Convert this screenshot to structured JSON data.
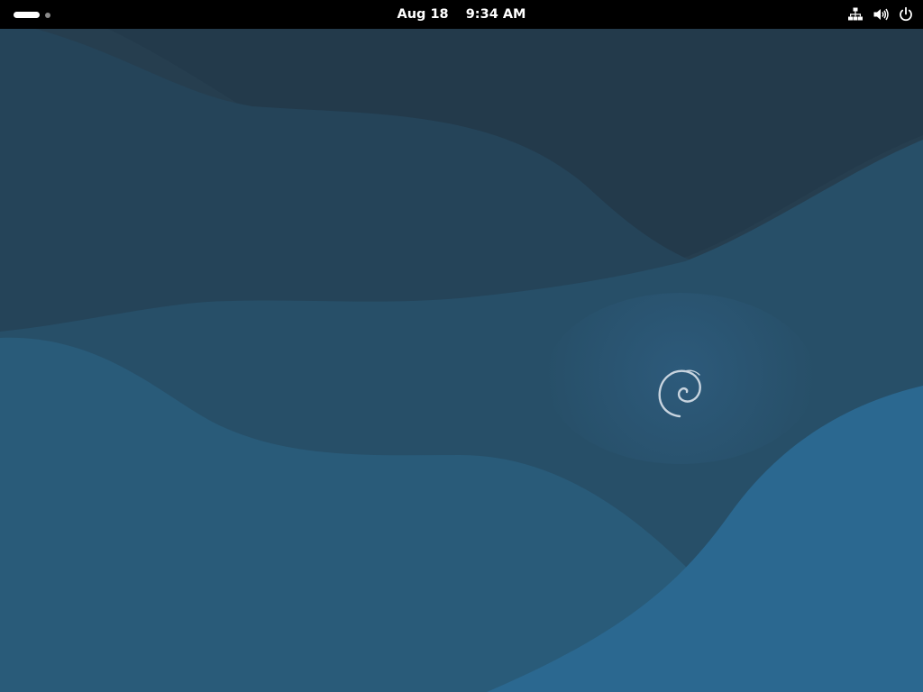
{
  "topbar": {
    "date": "Aug 18",
    "time": "9:34 AM",
    "activities_icon": "workspace-indicator-icon",
    "tray_icons": [
      "network-wired-icon",
      "volume-icon",
      "power-icon"
    ]
  },
  "desktop": {
    "wallpaper": "debian-emerald-waves",
    "logo_icon": "debian-swirl-icon",
    "colors": {
      "panel": "#000000",
      "wave_dark": "#263f52",
      "wave_mid": "#2a5670",
      "wave_light": "#2b6a92"
    }
  }
}
